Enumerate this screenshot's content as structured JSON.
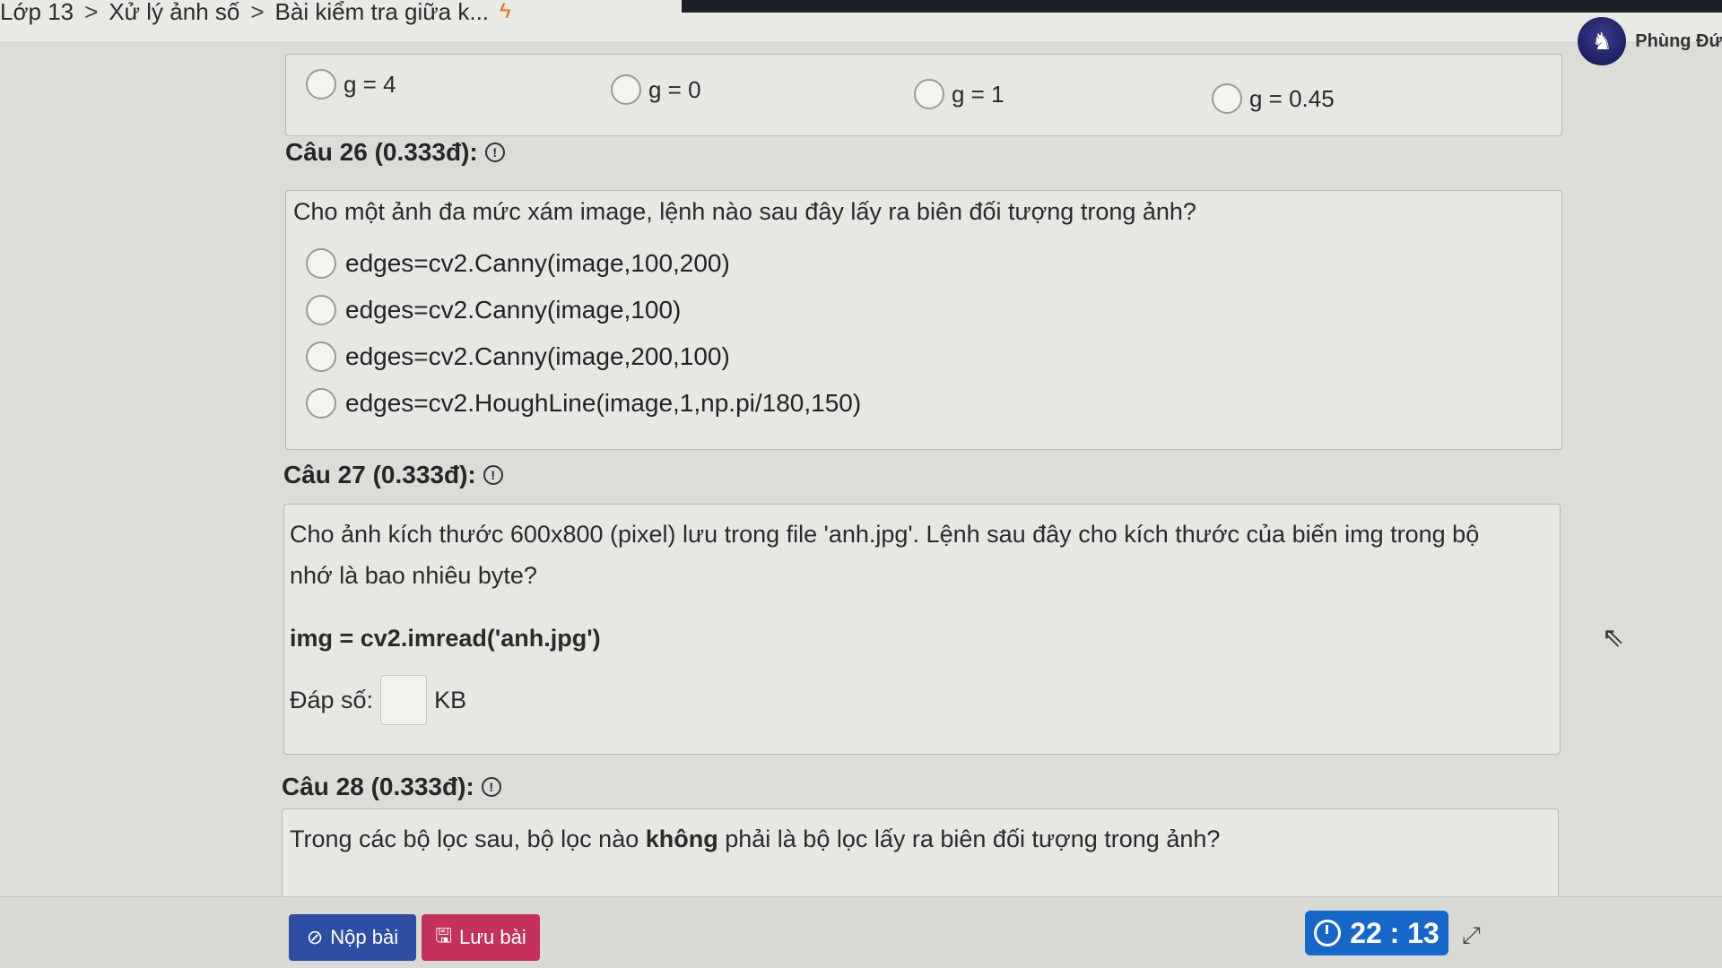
{
  "breadcrumb": {
    "items": [
      "Lớp 13",
      "Xử lý ảnh số",
      "Bài kiểm tra giữa k..."
    ],
    "separator": ">",
    "icon": "bolt-icon"
  },
  "user": {
    "name": "Phùng Đứ",
    "avatar_icon": "user-avatar-icon"
  },
  "previous_question_options": [
    "g = 4",
    "g = 0",
    "g = 1",
    "g = 0.45"
  ],
  "questions": [
    {
      "header": "Câu 26 (0.333đ):",
      "text": "Cho một ảnh đa mức xám image, lệnh nào sau đây lấy ra biên đối tượng trong ảnh?",
      "options": [
        "edges=cv2.Canny(image,100,200)",
        "edges=cv2.Canny(image,100)",
        "edges=cv2.Canny(image,200,100)",
        "edges=cv2.HoughLine(image,1,np.pi/180,150)"
      ]
    },
    {
      "header": "Câu 27 (0.333đ):",
      "text_line1": "Cho ảnh kích thước 600x800 (pixel) lưu trong file 'anh.jpg'. Lệnh sau đây cho kích thước của biến img trong bộ",
      "text_line2": "nhớ là bao nhiêu byte?",
      "code": "img = cv2.imread('anh.jpg')",
      "answer_label": "Đáp số:",
      "answer_value": "",
      "answer_unit": "KB"
    },
    {
      "header": "Câu 28 (0.333đ):",
      "text_before": "Trong các bộ lọc sau, bộ lọc nào ",
      "text_bold": "không",
      "text_after": " phải là bộ lọc lấy ra biên đối tượng trong ảnh?"
    }
  ],
  "footer": {
    "submit_label": "Nộp bài",
    "save_label": "Lưu bài",
    "timer": "22 : 13"
  },
  "colors": {
    "submit": "#2f4ea3",
    "save": "#c2325a",
    "timer": "#1667c7",
    "accent_bolt": "#e8711a"
  }
}
